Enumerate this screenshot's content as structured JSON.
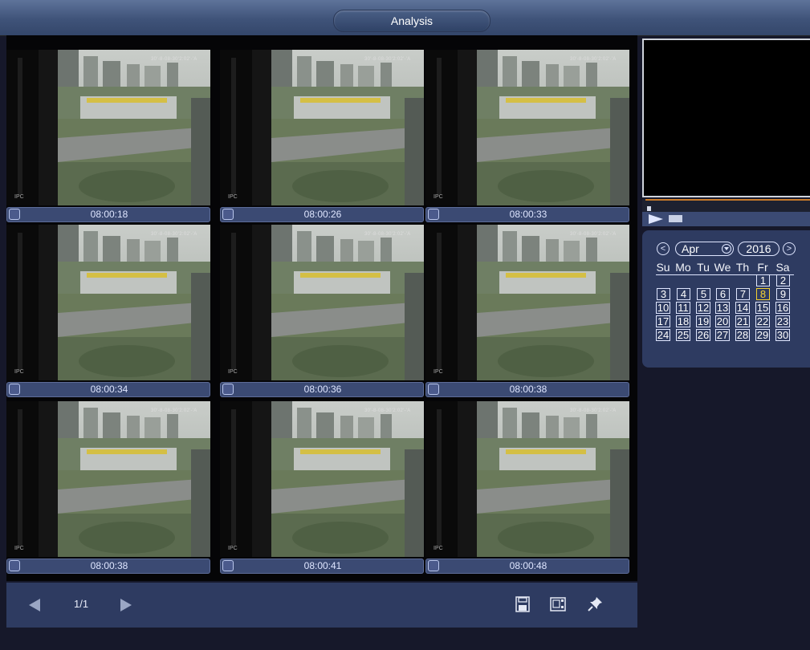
{
  "window": {
    "title": "Analysis"
  },
  "thumbnails": [
    {
      "time": "08:00:18",
      "channel": "IPC",
      "stamp": "30'-8-08-30'2:02'-'A"
    },
    {
      "time": "08:00:26",
      "channel": "IPC",
      "stamp": "30'-8-08-30'2:02'-'A"
    },
    {
      "time": "08:00:33",
      "channel": "IPC",
      "stamp": "30'-8-08-30'2:02'-'A"
    },
    {
      "time": "08:00:34",
      "channel": "IPC",
      "stamp": "30'-8-08-30'2:02'-'A"
    },
    {
      "time": "08:00:36",
      "channel": "IPC",
      "stamp": "30'-8-08-30'2:02'-'A"
    },
    {
      "time": "08:00:38",
      "channel": "IPC",
      "stamp": "30'-8-08-30'2:02'-'A"
    },
    {
      "time": "08:00:38",
      "channel": "IPC",
      "stamp": "30'-8-08-30'2:02'-'A"
    },
    {
      "time": "08:00:41",
      "channel": "IPC",
      "stamp": "30'-8-08-30'2:02'-'A"
    },
    {
      "time": "08:00:48",
      "channel": "IPC",
      "stamp": "30'-8-08-30'2:02'-'A"
    }
  ],
  "pagination": {
    "page": "1/1"
  },
  "toolbar": {
    "icons": [
      "save-icon",
      "clip-icon",
      "pin-icon"
    ]
  },
  "calendar": {
    "prev": "<",
    "next": ">",
    "month": "Apr",
    "year": "2016",
    "weekdays": [
      "Su",
      "Mo",
      "Tu",
      "We",
      "Th",
      "Fr",
      "Sa"
    ],
    "rows": [
      [
        "",
        "",
        "",
        "",
        "",
        "1",
        "2"
      ],
      [
        "3",
        "4",
        "5",
        "6",
        "7",
        "8",
        "9"
      ],
      [
        "10",
        "11",
        "12",
        "13",
        "14",
        "15",
        "16"
      ],
      [
        "17",
        "18",
        "19",
        "20",
        "21",
        "22",
        "23"
      ],
      [
        "24",
        "25",
        "26",
        "27",
        "28",
        "29",
        "30"
      ]
    ],
    "today": "8"
  },
  "colors": {
    "accent": "#3b4a73",
    "today": "#f4d232",
    "background": "#16182a"
  }
}
